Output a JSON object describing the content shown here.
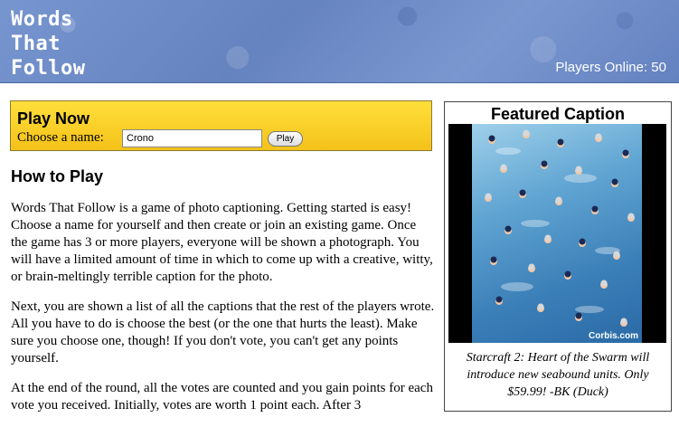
{
  "header": {
    "title_lines": [
      "Words",
      "That",
      "Follow"
    ],
    "players_online": "Players Online: 50"
  },
  "play_now": {
    "title": "Play Now",
    "choose_label": "Choose a name:",
    "name_value": "Crono",
    "play_button": "Play"
  },
  "how_to_play": {
    "title": "How to Play",
    "paragraphs": [
      "Words That Follow is a game of photo captioning. Getting started is easy! Choose a name for yourself and then create or join an existing game. Once the game has 3 or more players, everyone will be shown a photograph. You will have a limited amount of time in which to come up with a creative, witty, or brain-meltingly terrible caption for the photo.",
      "Next, you are shown a list of all the captions that the rest of the players wrote. All you have to do is choose the best (or the one that hurts the least). Make sure you choose one, though! If you don't vote, you can't get any points yourself.",
      "At the end of the round, all the votes are counted and you gain points for each vote you received. Initially, votes are worth 1 point each. After 3"
    ]
  },
  "featured": {
    "title": "Featured Caption",
    "photo_credit": "Corbis.com",
    "caption": "Starcraft 2: Heart of the Swarm will introduce new seabound units. Only $59.99! -BK (Duck)",
    "photo_icon": "swimmers-photo"
  },
  "colors": {
    "header_bg": "#6f8cc6",
    "play_box_bg": "#f4c21a"
  }
}
